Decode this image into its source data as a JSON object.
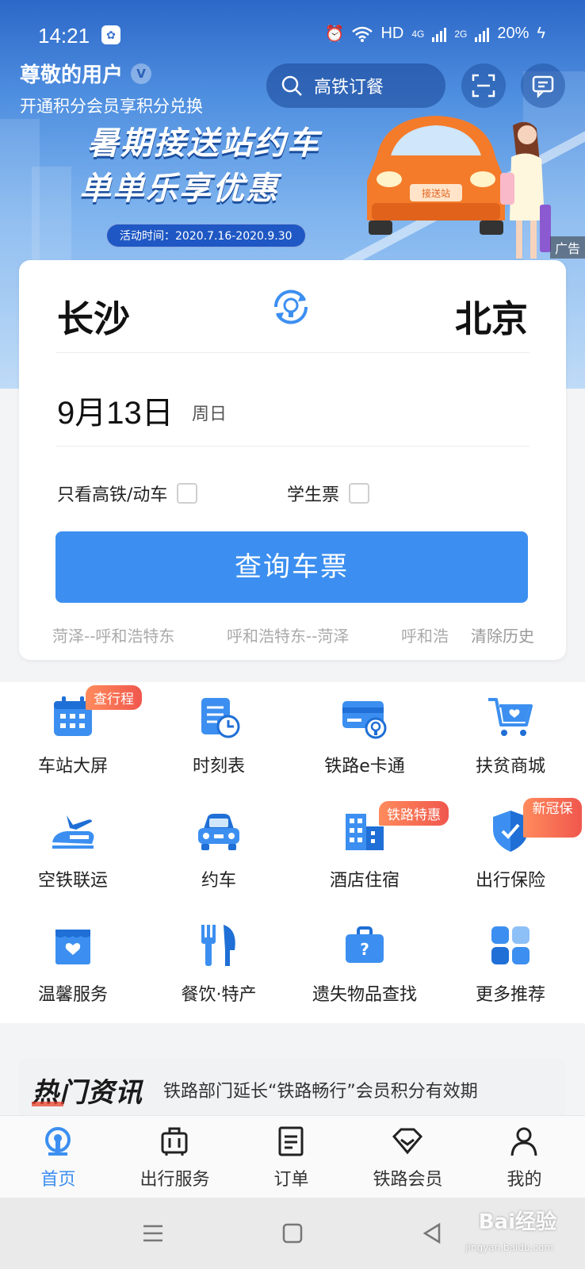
{
  "status_bar": {
    "time": "14:21",
    "network_label": "HD",
    "signal1_label": "4G",
    "signal2_label": "2G",
    "battery": "20%"
  },
  "header": {
    "greeting": "尊敬的用户",
    "vip_badge": "V",
    "member_tip": "开通积分会员享积分兑换",
    "search_placeholder": "高铁订餐"
  },
  "banner": {
    "line1": "暑期接送站约车",
    "line2": "单单乐享优惠",
    "activity_time": "活动时间：2020.7.16-2020.9.30",
    "car_sign": "接送站",
    "ad_label": "广告"
  },
  "booking": {
    "from_city": "长沙",
    "to_city": "北京",
    "date": "9月13日",
    "weekday": "周日",
    "only_high_speed_label": "只看高铁/动车",
    "student_ticket_label": "学生票",
    "query_button": "查询车票",
    "history": [
      "菏泽--呼和浩特东",
      "呼和浩特东--菏泽",
      "呼和浩"
    ],
    "clear_history": "清除历史"
  },
  "services": [
    {
      "label": "车站大屏",
      "icon": "calendar-icon",
      "tag": "查行程"
    },
    {
      "label": "时刻表",
      "icon": "timetable-icon",
      "tag": ""
    },
    {
      "label": "铁路e卡通",
      "icon": "ecard-icon",
      "tag": ""
    },
    {
      "label": "扶贫商城",
      "icon": "cart-icon",
      "tag": ""
    },
    {
      "label": "空铁联运",
      "icon": "plane-train-icon",
      "tag": ""
    },
    {
      "label": "约车",
      "icon": "car-icon",
      "tag": ""
    },
    {
      "label": "酒店住宿",
      "icon": "hotel-icon",
      "tag": "铁路特惠"
    },
    {
      "label": "出行保险",
      "icon": "shield-icon",
      "tag": "新冠保"
    },
    {
      "label": "温馨服务",
      "icon": "heart-service-icon",
      "tag": ""
    },
    {
      "label": "餐饮·特产",
      "icon": "dining-icon",
      "tag": ""
    },
    {
      "label": "遗失物品查找",
      "icon": "lost-found-icon",
      "tag": ""
    },
    {
      "label": "更多推荐",
      "icon": "more-grid-icon",
      "tag": ""
    }
  ],
  "news": {
    "title": "热门资讯",
    "headline": "铁路部门延长“铁路畅行”会员积分有效期"
  },
  "tabs": [
    {
      "label": "首页",
      "icon": "home-rail-icon",
      "active": true
    },
    {
      "label": "出行服务",
      "icon": "luggage-icon",
      "active": false
    },
    {
      "label": "订单",
      "icon": "order-icon",
      "active": false
    },
    {
      "label": "铁路会员",
      "icon": "diamond-icon",
      "active": false
    },
    {
      "label": "我的",
      "icon": "person-icon",
      "active": false
    }
  ],
  "watermark": {
    "brand": "Bai经验",
    "url": "jingyan.baidu.com"
  },
  "colors": {
    "primary": "#3c8ff0",
    "tag_gradient": "#f0574d"
  }
}
